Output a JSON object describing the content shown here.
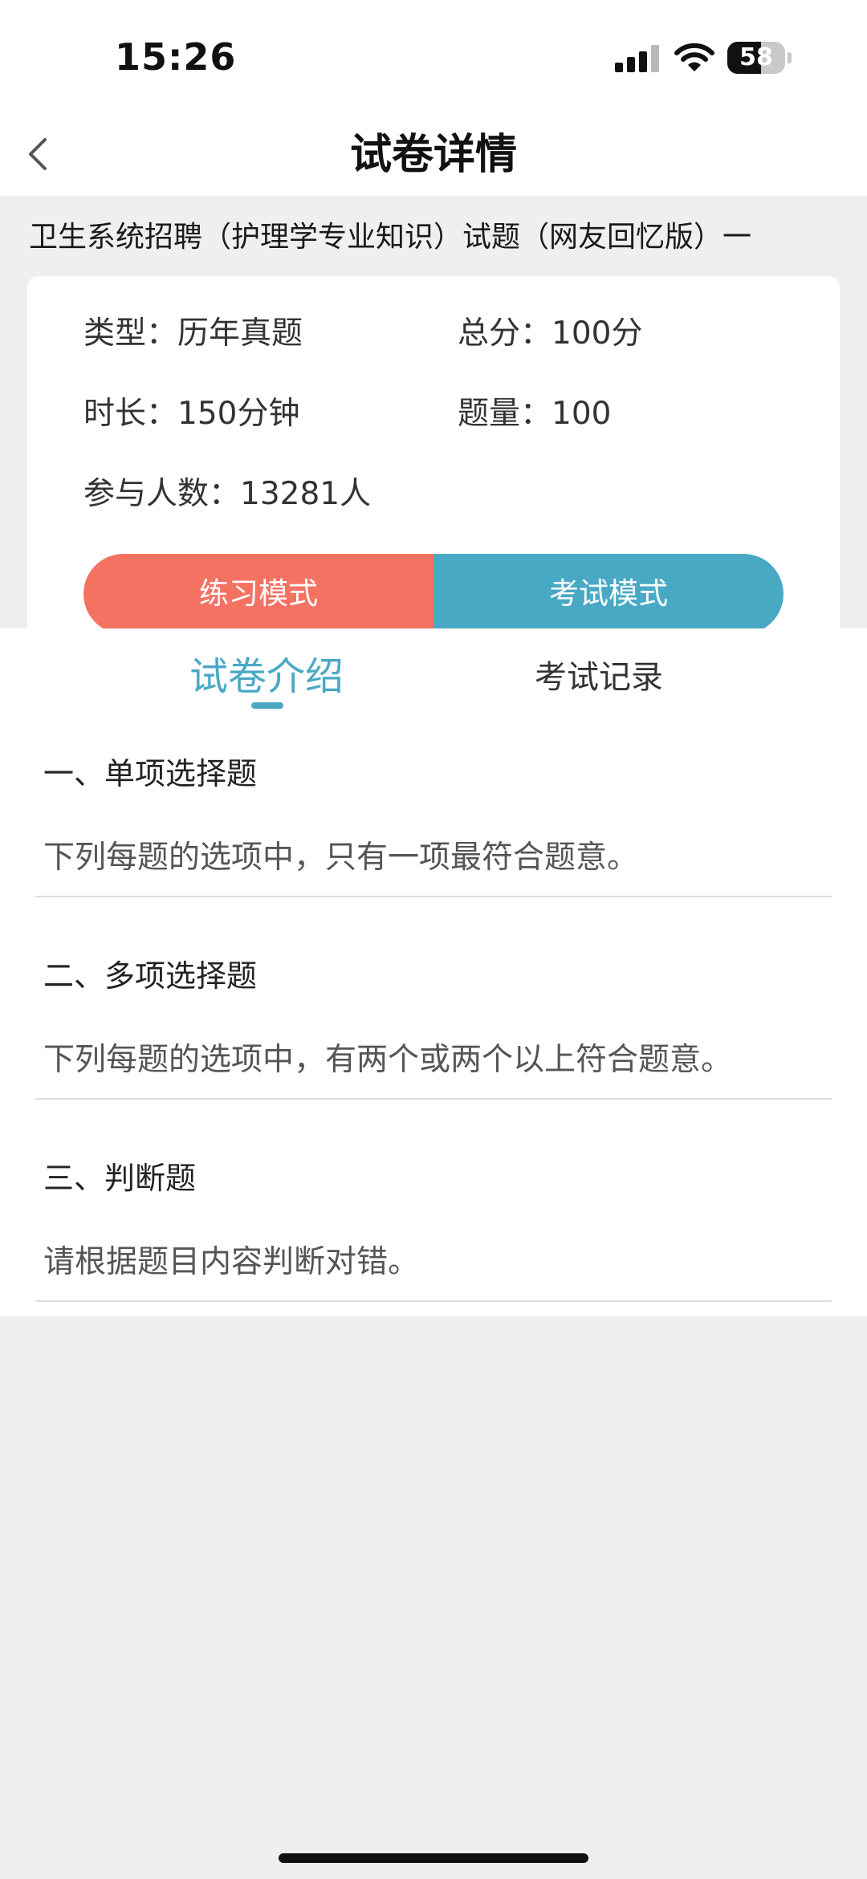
{
  "status_bar": {
    "time": "15:26",
    "battery_level": "58",
    "icons": [
      "signal-icon",
      "wifi-icon",
      "battery-icon"
    ]
  },
  "nav": {
    "title": "试卷详情",
    "back_icon": "chevron-left-icon"
  },
  "paper": {
    "title": "卫生系统招聘（护理学专业知识）试题（网友回忆版）一",
    "type": "类型：历年真题",
    "total_score": "总分：100分",
    "duration": "时长：150分钟",
    "question_count": "题量：100",
    "participants": "参与人数：13281人"
  },
  "modes": {
    "practice_label": "练习模式",
    "exam_label": "考试模式"
  },
  "tabs": [
    {
      "label": "试卷介绍",
      "active": true
    },
    {
      "label": "考试记录",
      "active": false
    }
  ],
  "sections": [
    {
      "heading": "一、单项选择题",
      "description": "下列每题的选项中，只有一项最符合题意。"
    },
    {
      "heading": "二、多项选择题",
      "description": "下列每题的选项中，有两个或两个以上符合题意。"
    },
    {
      "heading": "三、判断题",
      "description": "请根据题目内容判断对错。"
    }
  ],
  "colors": {
    "accent": "#49a9c5",
    "practice": "#f47262",
    "background": "#efefef"
  }
}
